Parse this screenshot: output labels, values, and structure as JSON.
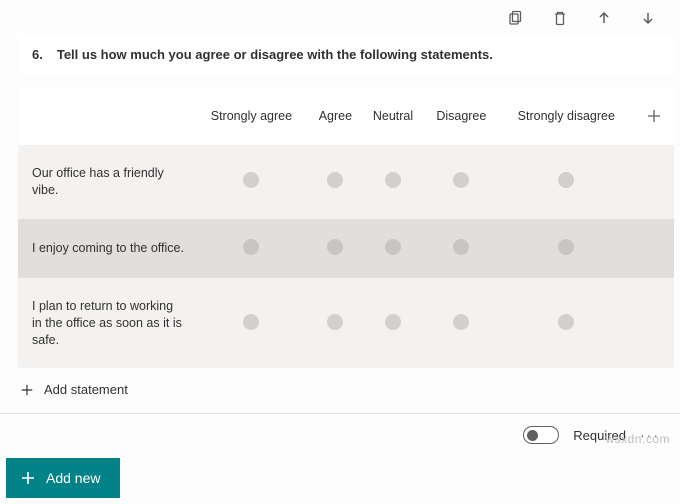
{
  "toolbar": {
    "icons": [
      "copy",
      "delete",
      "move-up",
      "move-down"
    ]
  },
  "question": {
    "number": "6.",
    "text": "Tell us how much you agree or disagree with the following statements."
  },
  "likert": {
    "columns": [
      "Strongly agree",
      "Agree",
      "Neutral",
      "Disagree",
      "Strongly disagree"
    ],
    "statements": [
      "Our office has a friendly vibe.",
      "I enjoy coming to the office.",
      "I plan to return to working in the office as soon as it is safe."
    ]
  },
  "actions": {
    "add_statement": "Add statement",
    "add_new": "Add new"
  },
  "footer": {
    "required_label": "Required",
    "required_on": false
  },
  "watermark": "wsxdn.com"
}
